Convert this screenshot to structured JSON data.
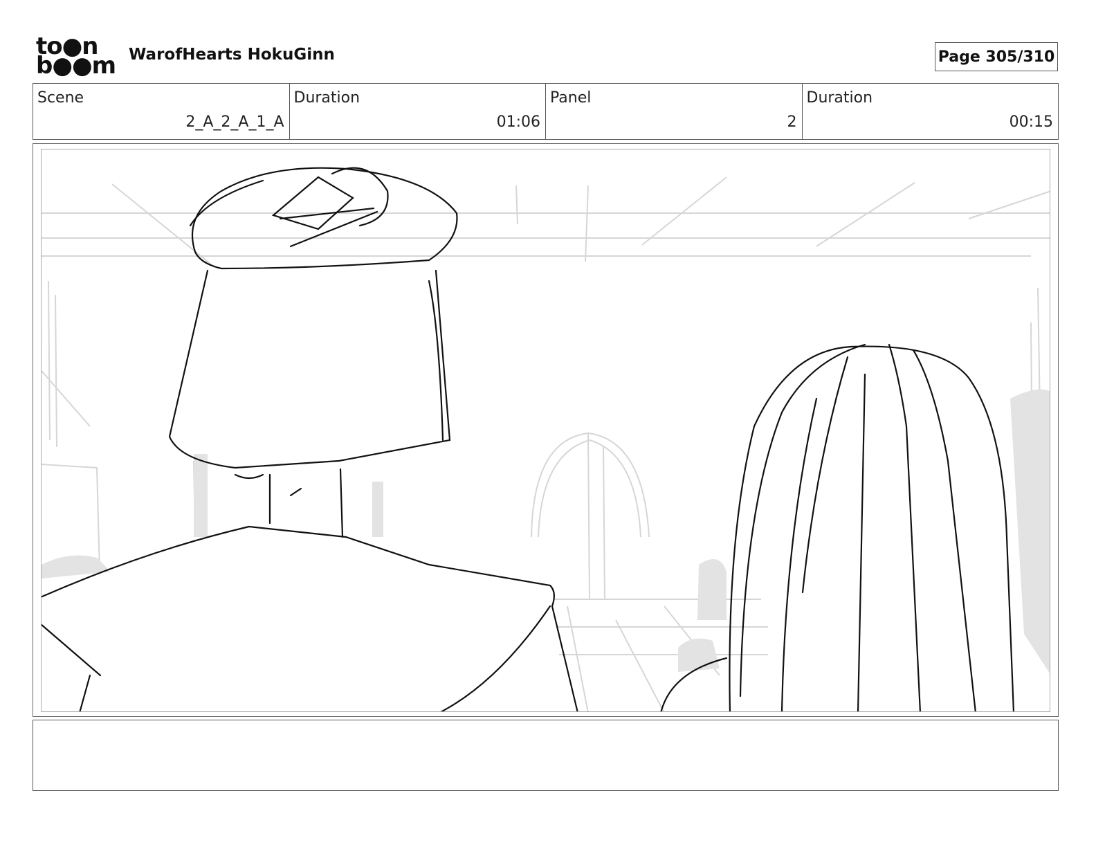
{
  "logo": {
    "line1": "to●n",
    "line2": "b●●m"
  },
  "project_title": "WarofHearts HokuGinn",
  "page_label": "Page 305/310",
  "info": [
    {
      "label": "Scene",
      "value": "2_A_2_A_1_A"
    },
    {
      "label": "Duration",
      "value": "01:06"
    },
    {
      "label": "Panel",
      "value": "2"
    },
    {
      "label": "Duration",
      "value": "00:15"
    }
  ],
  "notes": ""
}
